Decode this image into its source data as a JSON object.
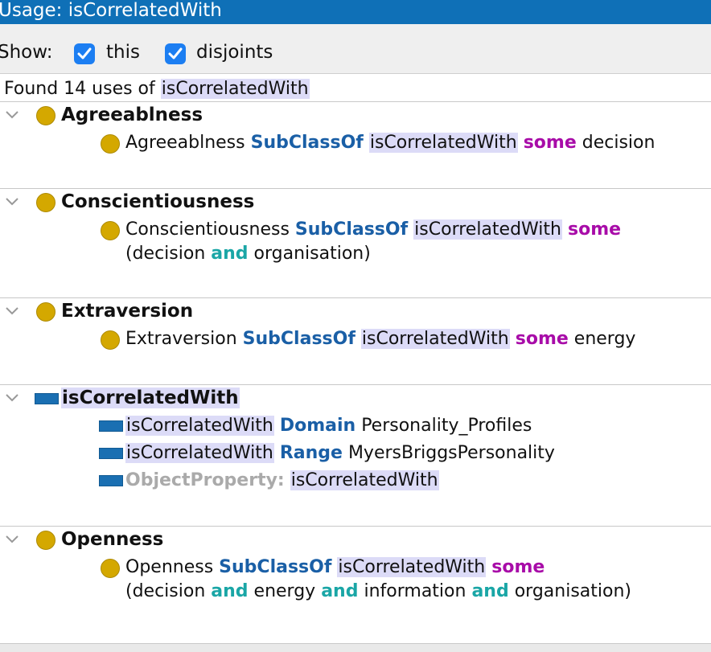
{
  "window": {
    "title": "Usage: isCorrelatedWith"
  },
  "show": {
    "label": "Show:",
    "options": [
      {
        "label": "this",
        "checked": true
      },
      {
        "label": "disjoints",
        "checked": true
      }
    ]
  },
  "found": {
    "prefix": "Found 14 uses of",
    "entity": "isCorrelatedWith"
  },
  "keywords": {
    "subclassof": "SubClassOf",
    "some": "some",
    "and": "and",
    "domain": "Domain",
    "range": "Range",
    "objectproperty": "ObjectProperty:"
  },
  "sections": [
    {
      "heading": "Agreeablness",
      "axiom": {
        "subject": "Agreeablness",
        "property": "isCorrelatedWith",
        "filler": "decision"
      }
    },
    {
      "heading": "Conscientiousness",
      "axiom": {
        "subject": "Conscientiousness",
        "property": "isCorrelatedWith",
        "filler_open": "(decision",
        "filler_a": "organisation)"
      }
    },
    {
      "heading": "Extraversion",
      "axiom": {
        "subject": "Extraversion",
        "property": "isCorrelatedWith",
        "filler": "energy"
      }
    },
    {
      "heading": "isCorrelatedWith",
      "domain_axiom": {
        "subject": "isCorrelatedWith",
        "value": "Personality_Profiles"
      },
      "range_axiom": {
        "subject": "isCorrelatedWith",
        "value": "MyersBriggsPersonality"
      },
      "declaration": {
        "value": "isCorrelatedWith"
      }
    },
    {
      "heading": "Openness",
      "axiom": {
        "subject": "Openness",
        "property": "isCorrelatedWith",
        "f1": "(decision",
        "f2": "energy",
        "f3": "information",
        "f4": "organisation)"
      }
    }
  ],
  "colors": {
    "titlebar": "#0f70b7",
    "class_icon": "#d4a800",
    "property_icon": "#1a6fb2",
    "highlight": "#dcdbf7",
    "keyword_blue": "#1a5fa6",
    "keyword_purple": "#a80ca8",
    "keyword_teal": "#1aa6a6"
  },
  "icons": {
    "class": "class-icon",
    "property": "object-property-icon",
    "expand": "chevron-down-icon",
    "checkbox": "checkmark-icon"
  }
}
